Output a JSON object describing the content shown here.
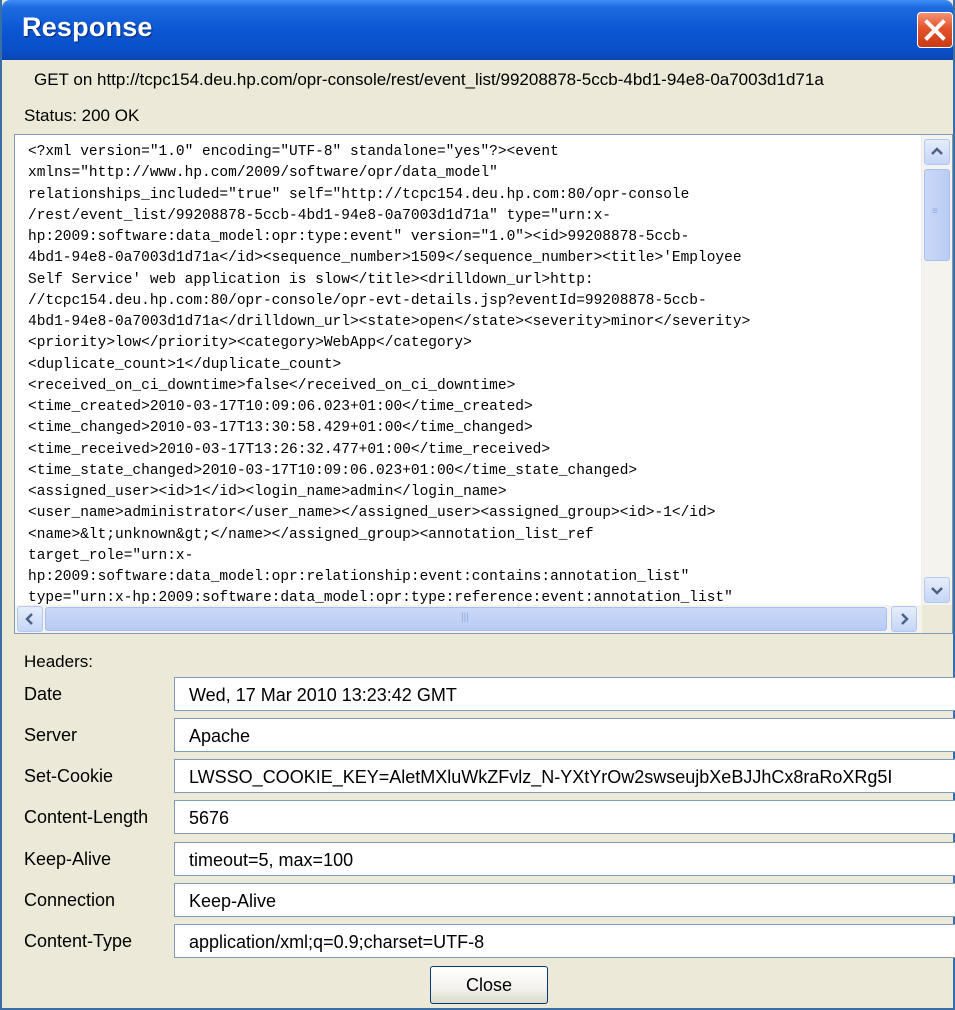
{
  "window": {
    "title": "Response"
  },
  "request_line": "GET on http://tcpc154.deu.hp.com/opr-console/rest/event_list/99208878-5ccb-4bd1-94e8-0a7003d1d71a",
  "status": "Status:  200 OK",
  "body_lines": [
    "<?xml version=\"1.0\" encoding=\"UTF-8\" standalone=\"yes\"?><event",
    "xmlns=\"http://www.hp.com/2009/software/opr/data_model\"",
    "relationships_included=\"true\" self=\"http://tcpc154.deu.hp.com:80/opr-console",
    "/rest/event_list/99208878-5ccb-4bd1-94e8-0a7003d1d71a\" type=\"urn:x-",
    "hp:2009:software:data_model:opr:type:event\" version=\"1.0\"><id>99208878-5ccb-",
    "4bd1-94e8-0a7003d1d71a</id><sequence_number>1509</sequence_number><title>'Employee",
    "Self Service' web application is slow</title><drilldown_url>http:",
    "//tcpc154.deu.hp.com:80/opr-console/opr-evt-details.jsp?eventId=99208878-5ccb-",
    "4bd1-94e8-0a7003d1d71a</drilldown_url><state>open</state><severity>minor</severity>",
    "<priority>low</priority><category>WebApp</category>",
    "<duplicate_count>1</duplicate_count>",
    "<received_on_ci_downtime>false</received_on_ci_downtime>",
    "<time_created>2010-03-17T10:09:06.023+01:00</time_created>",
    "<time_changed>2010-03-17T13:30:58.429+01:00</time_changed>",
    "<time_received>2010-03-17T13:26:32.477+01:00</time_received>",
    "<time_state_changed>2010-03-17T10:09:06.023+01:00</time_state_changed>",
    "<assigned_user><id>1</id><login_name>admin</login_name>",
    "<user_name>administrator</user_name></assigned_user><assigned_group><id>-1</id>",
    "<name>&lt;unknown&gt;</name></assigned_group><annotation_list_ref",
    "target_role=\"urn:x-",
    "hp:2009:software:data_model:opr:relationship:event:contains:annotation_list\"",
    "type=\"urn:x-hp:2009:software:data_model:opr:type:reference:event:annotation_list\""
  ],
  "headers_label": "Headers:",
  "headers": [
    {
      "name": "Date",
      "value": "Wed, 17 Mar 2010 13:23:42 GMT"
    },
    {
      "name": "Server",
      "value": "Apache"
    },
    {
      "name": "Set-Cookie",
      "value": "LWSSO_COOKIE_KEY=AletMXluWkZFvlz_N-YXtYrOw2swseujbXeBJJhCx8raRoXRg5I"
    },
    {
      "name": "Content-Length",
      "value": "5676"
    },
    {
      "name": "Keep-Alive",
      "value": "timeout=5, max=100"
    },
    {
      "name": "Connection",
      "value": "Keep-Alive"
    },
    {
      "name": "Content-Type",
      "value": "application/xml;q=0.9;charset=UTF-8"
    }
  ],
  "buttons": {
    "close": "Close"
  }
}
